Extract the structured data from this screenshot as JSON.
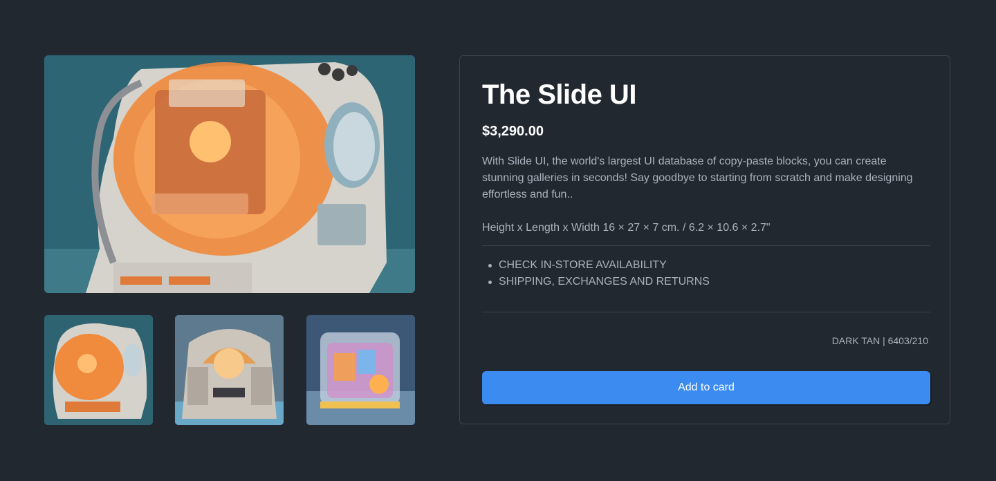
{
  "product": {
    "title": "The Slide UI",
    "price": "$3,290.00",
    "description": "With Slide UI, the world's largest UI database of copy-paste blocks, you can create stunning galleries in seconds! Say goodbye to starting from scratch and make designing effortless and fun..",
    "dimensions": "Height x Length x Width 16 × 27 × 7 cm. / 6.2 × 10.6 × 2.7\"",
    "links": [
      "CHECK IN-STORE AVAILABILITY",
      "SHIPPING, EXCHANGES AND RETURNS"
    ],
    "sku": "DARK TAN | 6403/210",
    "add_button_label": "Add to card"
  },
  "gallery": {
    "main_image": "retro-robot-orange-dome-image",
    "thumbnails": [
      "retro-robot-orange-thumbnail",
      "retro-console-dome-thumbnail",
      "neon-transparent-machine-thumbnail"
    ]
  },
  "colors": {
    "background": "#222830",
    "panel_border": "#3c434d",
    "accent": "#3b8bf0",
    "text_muted": "#aab2bd"
  }
}
